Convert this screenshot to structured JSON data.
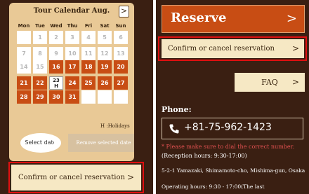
{
  "calendar": {
    "title": "Tour Calendar Aug.",
    "next_label": ">",
    "weekdays": [
      "Mon",
      "Tue",
      "Wed",
      "Thu",
      "Fri",
      "Sat",
      "Sun"
    ],
    "weeks": [
      [
        {
          "day": "",
          "state": "empty"
        },
        {
          "day": "1",
          "state": "inactive"
        },
        {
          "day": "2",
          "state": "inactive"
        },
        {
          "day": "3",
          "state": "inactive"
        },
        {
          "day": "4",
          "state": "inactive"
        },
        {
          "day": "5",
          "state": "inactive"
        },
        {
          "day": "6",
          "state": "inactive"
        }
      ],
      [
        {
          "day": "7",
          "state": "inactive"
        },
        {
          "day": "8",
          "state": "inactive"
        },
        {
          "day": "9",
          "state": "inactive"
        },
        {
          "day": "10",
          "state": "inactive"
        },
        {
          "day": "11",
          "state": "inactive"
        },
        {
          "day": "12",
          "state": "inactive"
        },
        {
          "day": "13",
          "state": "inactive"
        }
      ],
      [
        {
          "day": "14",
          "state": "inactive"
        },
        {
          "day": "15",
          "state": "inactive"
        },
        {
          "day": "16",
          "state": "active"
        },
        {
          "day": "17",
          "state": "active"
        },
        {
          "day": "18",
          "state": "active"
        },
        {
          "day": "19",
          "state": "active"
        },
        {
          "day": "20",
          "state": "active"
        }
      ],
      [
        {
          "day": "21",
          "state": "active"
        },
        {
          "day": "22",
          "state": "active"
        },
        {
          "day": "23",
          "state": "selected",
          "mark": "H"
        },
        {
          "day": "24",
          "state": "active"
        },
        {
          "day": "25",
          "state": "active"
        },
        {
          "day": "26",
          "state": "active"
        },
        {
          "day": "27",
          "state": "active"
        }
      ],
      [
        {
          "day": "28",
          "state": "active"
        },
        {
          "day": "29",
          "state": "active"
        },
        {
          "day": "30",
          "state": "active"
        },
        {
          "day": "31",
          "state": "active"
        },
        {
          "day": "",
          "state": "empty"
        },
        {
          "day": "",
          "state": "empty"
        },
        {
          "day": "",
          "state": "empty"
        }
      ]
    ],
    "holidays_note": "H :Holidays",
    "select_date": "Select date",
    "remove_selected_date": "Remove selected date"
  },
  "left_confirm": {
    "label": "Confirm or cancel reservation",
    "chevron": ">"
  },
  "reserve": {
    "label": "Reserve",
    "chevron": ">"
  },
  "right_confirm": {
    "label": "Confirm or cancel reservation",
    "chevron": ">"
  },
  "faq": {
    "label": "FAQ",
    "chevron": ">"
  },
  "phone": {
    "heading": "Phone:",
    "number": "+81-75-962-1423",
    "dial_note": "* Please make sure to dial the correct number.",
    "reception_hours": "(Reception hours: 9:30-17:00)"
  },
  "address": "5-2-1 Yamazaki, Shimamoto-cho, Mishima-gun, Osaka",
  "operating_hours": "Operating hours: 9:30 - 17:00(The last",
  "colors": {
    "background": "#3a1f12",
    "accent": "#c84d14",
    "calendar_card": "#e9c996",
    "button_cream": "#f6e8c4",
    "highlight_outline": "#e01010"
  }
}
